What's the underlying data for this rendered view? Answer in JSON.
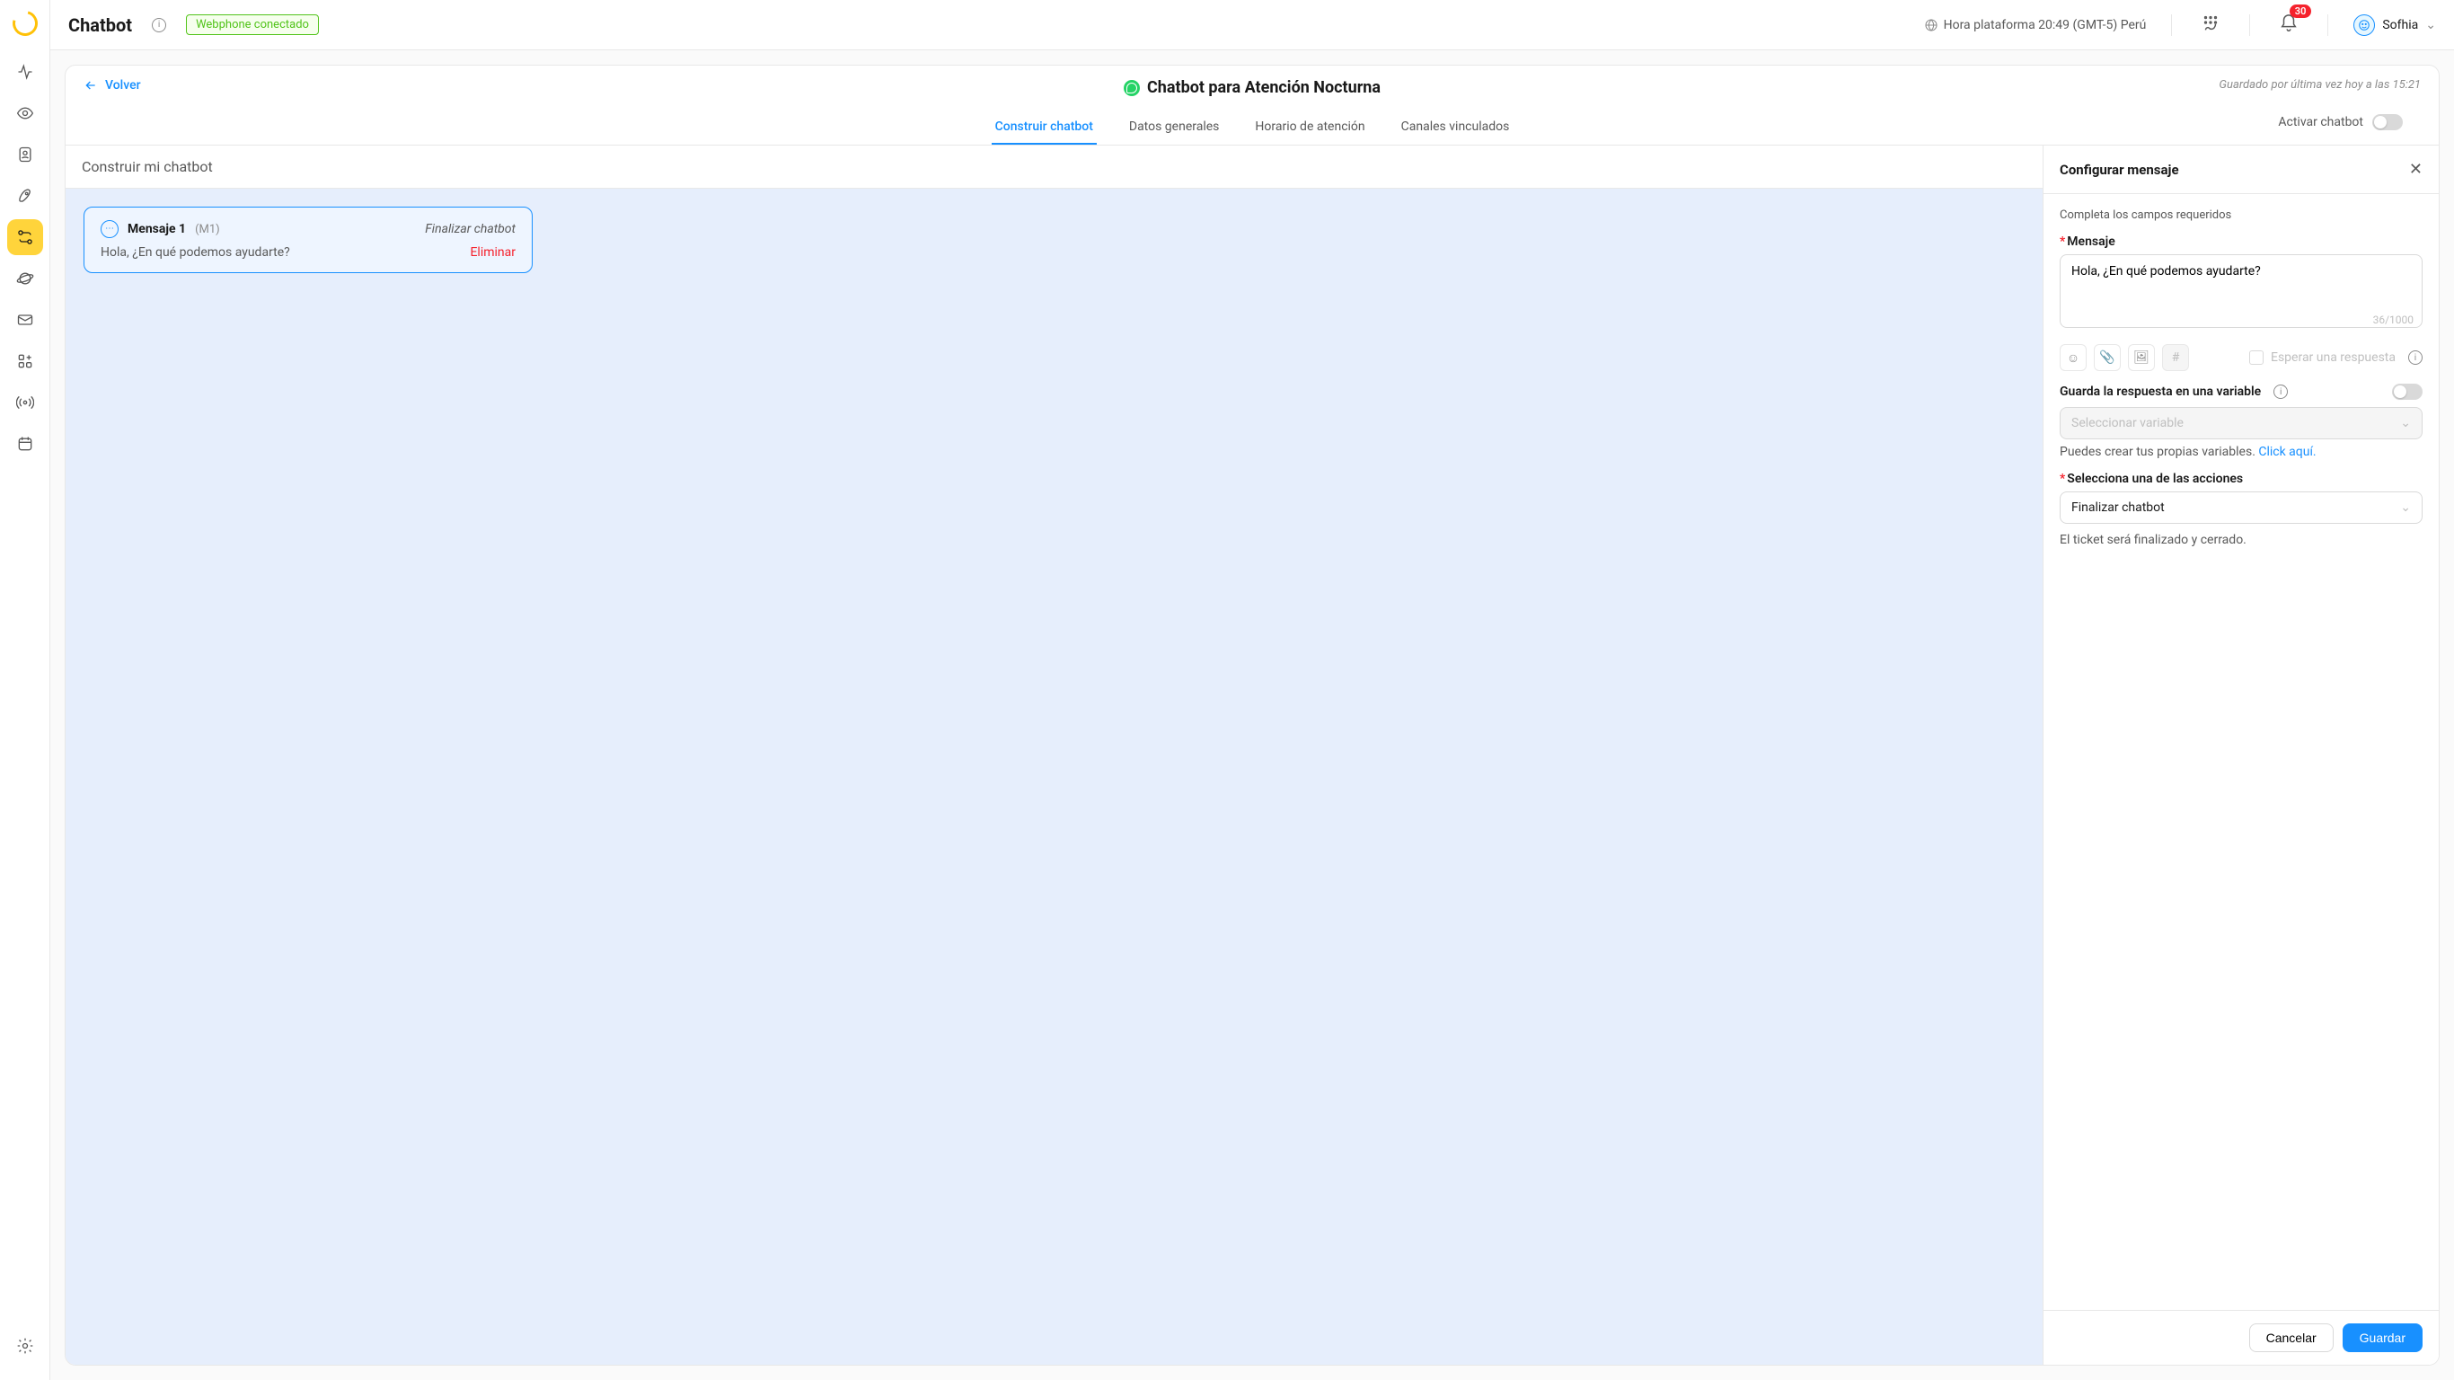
{
  "header": {
    "app_title": "Chatbot",
    "connection_badge": "Webphone conectado",
    "platform_time_label": "Hora plataforma 20:49 (GMT-5) Perú",
    "notification_count": "30",
    "user_name": "Sofhia"
  },
  "sidebar": {},
  "subheader": {
    "back_label": "Volver",
    "chatbot_name": "Chatbot para Atención Nocturna",
    "saved_label": "Guardado por última vez hoy a las 15:21",
    "activate_label": "Activar chatbot",
    "tabs": [
      {
        "label": "Construir  chatbot",
        "active": true
      },
      {
        "label": "Datos generales",
        "active": false
      },
      {
        "label": "Horario de atención",
        "active": false
      },
      {
        "label": "Canales vinculados",
        "active": false
      }
    ]
  },
  "builder": {
    "heading": "Construir mi chatbot",
    "message_card": {
      "title": "Mensaje 1",
      "code": "(M1)",
      "action_label": "Finalizar chatbot",
      "text": "Hola, ¿En qué podemos ayudarte?",
      "delete_label": "Eliminar"
    }
  },
  "config": {
    "panel_title": "Configurar mensaje",
    "helper_text": "Completa los campos requeridos",
    "message_label": "Mensaje",
    "message_value": "Hola, ¿En qué podemos ayudarte?",
    "char_count": "36/1000",
    "wait_response_label": "Esperar una respuesta",
    "save_var_label": "Guarda la respuesta en una variable",
    "select_var_placeholder": "Seleccionar variable",
    "var_hint_prefix": "Puedes crear tus propias variables. ",
    "var_hint_link": "Click aquí.",
    "action_label": "Selecciona una de las acciones",
    "action_value": "Finalizar chatbot",
    "action_note": "El ticket será finalizado y cerrado.",
    "cancel_label": "Cancelar",
    "save_label": "Guardar"
  }
}
